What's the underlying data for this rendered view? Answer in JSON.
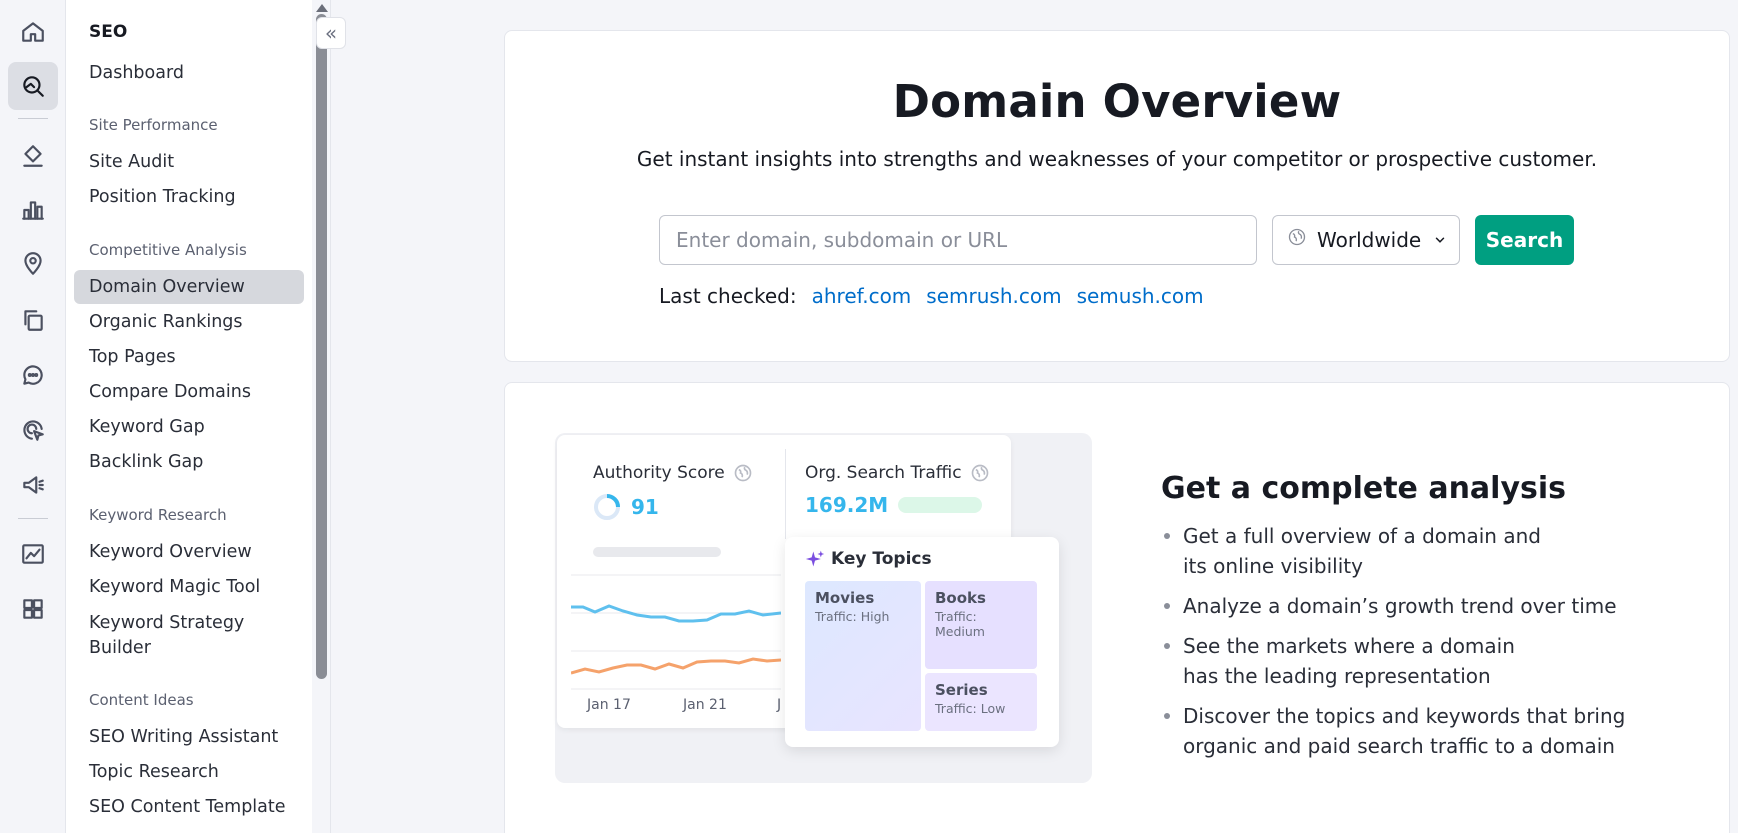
{
  "nav": {
    "seo_heading": "SEO",
    "dashboard": "Dashboard",
    "sections": {
      "site_performance": "Site Performance",
      "competitive_analysis": "Competitive Analysis",
      "keyword_research": "Keyword Research",
      "content_ideas": "Content Ideas"
    },
    "site_audit": "Site Audit",
    "position_tracking": "Position Tracking",
    "domain_overview": "Domain Overview",
    "organic_rankings": "Organic Rankings",
    "top_pages": "Top Pages",
    "compare_domains": "Compare Domains",
    "keyword_gap": "Keyword Gap",
    "backlink_gap": "Backlink Gap",
    "keyword_overview": "Keyword Overview",
    "keyword_magic_tool": "Keyword Magic Tool",
    "keyword_strategy_builder": "Keyword Strategy Builder",
    "seo_writing_assistant": "SEO Writing Assistant",
    "topic_research": "Topic Research",
    "seo_content_template": "SEO Content Template"
  },
  "collapse_glyph": "«",
  "hero": {
    "title": "Domain Overview",
    "subtitle": "Get instant insights into strengths and weaknesses of your competitor or prospective customer.",
    "search_placeholder": "Enter domain, subdomain or URL",
    "search_value": "",
    "region": "Worldwide",
    "search_button": "Search",
    "last_checked_label": "Last checked:",
    "last_checked": [
      "ahref.com",
      "semrush.com",
      "semush.com"
    ]
  },
  "illustration": {
    "authority_label": "Authority Score",
    "authority_value": "91",
    "traffic_label": "Org. Search Traffic",
    "traffic_value": "169.2M",
    "x_labels": [
      "Jan 17",
      "Jan 21",
      "J"
    ],
    "key_topics_label": "Key Topics",
    "topics": [
      {
        "name": "Movies",
        "traffic": "Traffic: High"
      },
      {
        "name": "Books",
        "traffic": "Traffic: Medium"
      },
      {
        "name": "Series",
        "traffic": "Traffic: Low"
      }
    ]
  },
  "analysis": {
    "title": "Get a complete analysis",
    "bullets": [
      "Get a full overview of a domain and its online visibility",
      "Analyze a domain’s growth trend over time",
      "See the markets where a domain has the leading representation",
      "Discover the topics and keywords that bring organic and paid search traffic to a domain"
    ]
  },
  "colors": {
    "accent_green": "#009f81",
    "link_blue": "#006dca",
    "metric_blue": "#35b6ec",
    "line_orange": "#f5a26b"
  },
  "icons": [
    "home-icon",
    "seo-toolkit-icon",
    "content-icon",
    "chart-bars-icon",
    "location-pin-icon",
    "copy-pages-icon",
    "chat-bubble-icon",
    "target-cursor-icon",
    "megaphone-icon",
    "analytics-icon",
    "apps-grid-icon",
    "globe-icon",
    "chevron-down-icon",
    "sparkle-icon"
  ]
}
